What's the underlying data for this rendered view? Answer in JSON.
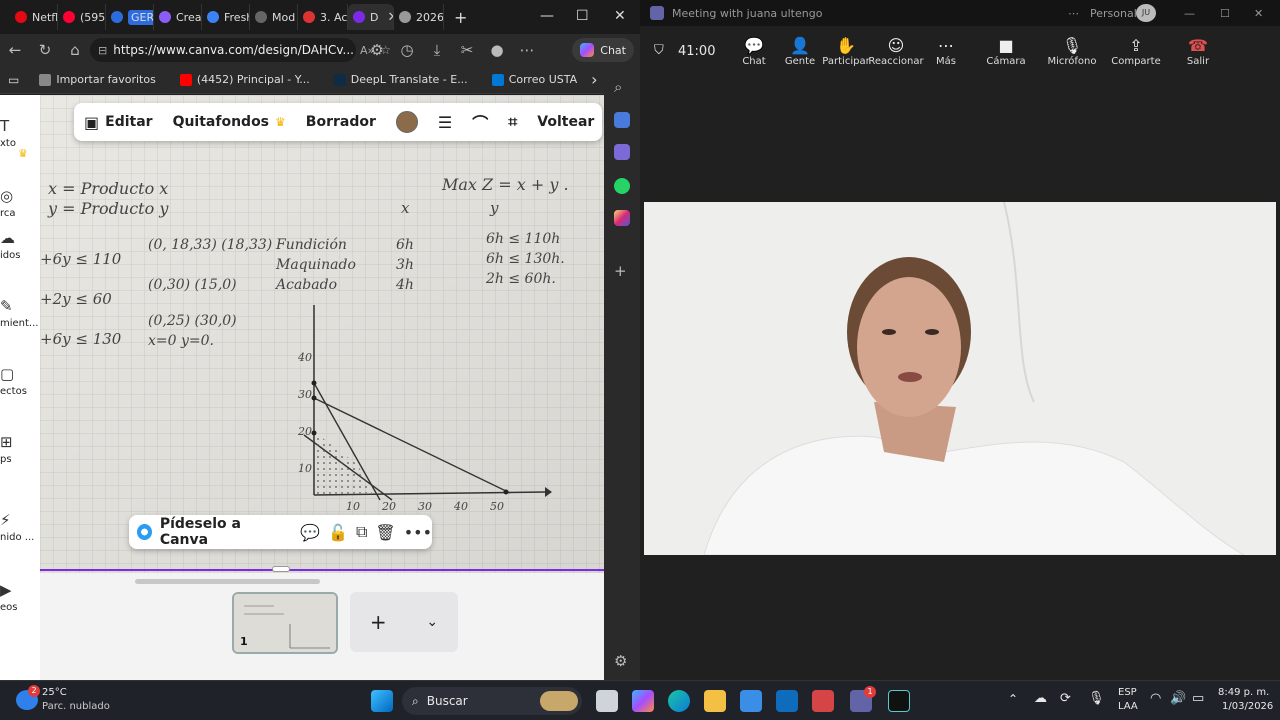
{
  "browser": {
    "tabs": [
      {
        "label": "Netfl",
        "color": "#e50914"
      },
      {
        "label": "(595)",
        "color": "#ff0033"
      },
      {
        "label": "GERE",
        "color": "#2d6cdf",
        "badge": true
      },
      {
        "label": "Crea",
        "color": "#8b5cf6"
      },
      {
        "label": "Fresh",
        "color": "#3b82f6"
      },
      {
        "label": "Mod",
        "color": "#666666"
      },
      {
        "label": "3. Ac",
        "color": "#d33"
      },
      {
        "label": "D",
        "color": "#7d2ae8",
        "active": true
      },
      {
        "label": "2026",
        "color": "#999999"
      }
    ],
    "url": "https://www.canva.com/design/DAHCv...",
    "chat_label": "Chat",
    "bookmarks": [
      {
        "label": "Importar favoritos",
        "color": "#888888"
      },
      {
        "label": "(4452) Principal - Y...",
        "color": "#ff0000"
      },
      {
        "label": "DeepL Translate - E...",
        "color": "#0f2b46"
      },
      {
        "label": "Correo USTA",
        "color": "#0078d4"
      }
    ]
  },
  "canva": {
    "toolbar": {
      "edit": "Editar",
      "bg_remove": "Quitafondos",
      "eraser": "Borrador",
      "flip": "Voltear",
      "color": "#8b6b4a"
    },
    "assistant": "Pídeselo a Canva",
    "rail": [
      {
        "label": "xto",
        "icon": "T"
      },
      {
        "label": "",
        "icon": "♛"
      },
      {
        "label": "rca",
        "icon": "◎"
      },
      {
        "label": "idos",
        "icon": "☁"
      },
      {
        "label": "mient...",
        "icon": "✎"
      },
      {
        "label": "ectos",
        "icon": "▢"
      },
      {
        "label": "ps",
        "icon": "⊞"
      },
      {
        "label": "nido ...",
        "icon": "⚡"
      },
      {
        "label": "eos",
        "icon": "▶"
      }
    ],
    "page_number": "1"
  },
  "notes": {
    "vars": [
      "x = Producto x",
      "y = Producto y"
    ],
    "objective": "Max Z = x + y .",
    "col_x": "x",
    "col_y": "y",
    "constraints_left": [
      "+6y ≤ 110",
      "+2y ≤ 60",
      "+6y ≤ 130"
    ],
    "points": [
      "(0, 18,33) (18,33)",
      "(0,30) (15,0)",
      "(0,25)  (30,0)",
      "x=0    y=0."
    ],
    "rows": [
      {
        "name": "Fundición",
        "x": "6h",
        "y": "6h  ≤ 110h"
      },
      {
        "name": "Maquinado",
        "x": "3h",
        "y": "6h  ≤ 130h."
      },
      {
        "name": "Acabado",
        "x": "4h",
        "y": "2h  ≤ 60h."
      }
    ],
    "y_ticks": [
      "40",
      "30",
      "20",
      "10"
    ],
    "x_ticks": [
      "10",
      "20",
      "30",
      "40",
      "50"
    ]
  },
  "meeting": {
    "title": "Meeting with juana ultengo",
    "account": "Personal",
    "avatar": "JU",
    "timer": "41:00",
    "buttons": [
      {
        "label": "Chat",
        "icon": "💬"
      },
      {
        "label": "Gente",
        "icon": "👤"
      },
      {
        "label": "Participar",
        "icon": "✋"
      },
      {
        "label": "Reaccionar",
        "icon": "☺"
      },
      {
        "label": "Más",
        "icon": "⋯"
      },
      {
        "label": "Cámara",
        "icon": "■"
      },
      {
        "label": "Micrófono",
        "icon": "🎙"
      },
      {
        "label": "Comparte",
        "icon": "⇪"
      },
      {
        "label": "Salir",
        "icon": "☎"
      }
    ]
  },
  "taskbar": {
    "weather_temp": "25°C",
    "weather_desc": "Parc. nublado",
    "weather_badge": "2",
    "search": "Buscar",
    "lang_top": "ESP",
    "lang_bottom": "LAA",
    "time": "8:49 p. m.",
    "date": "1/03/2026",
    "teams_badge": "1"
  }
}
